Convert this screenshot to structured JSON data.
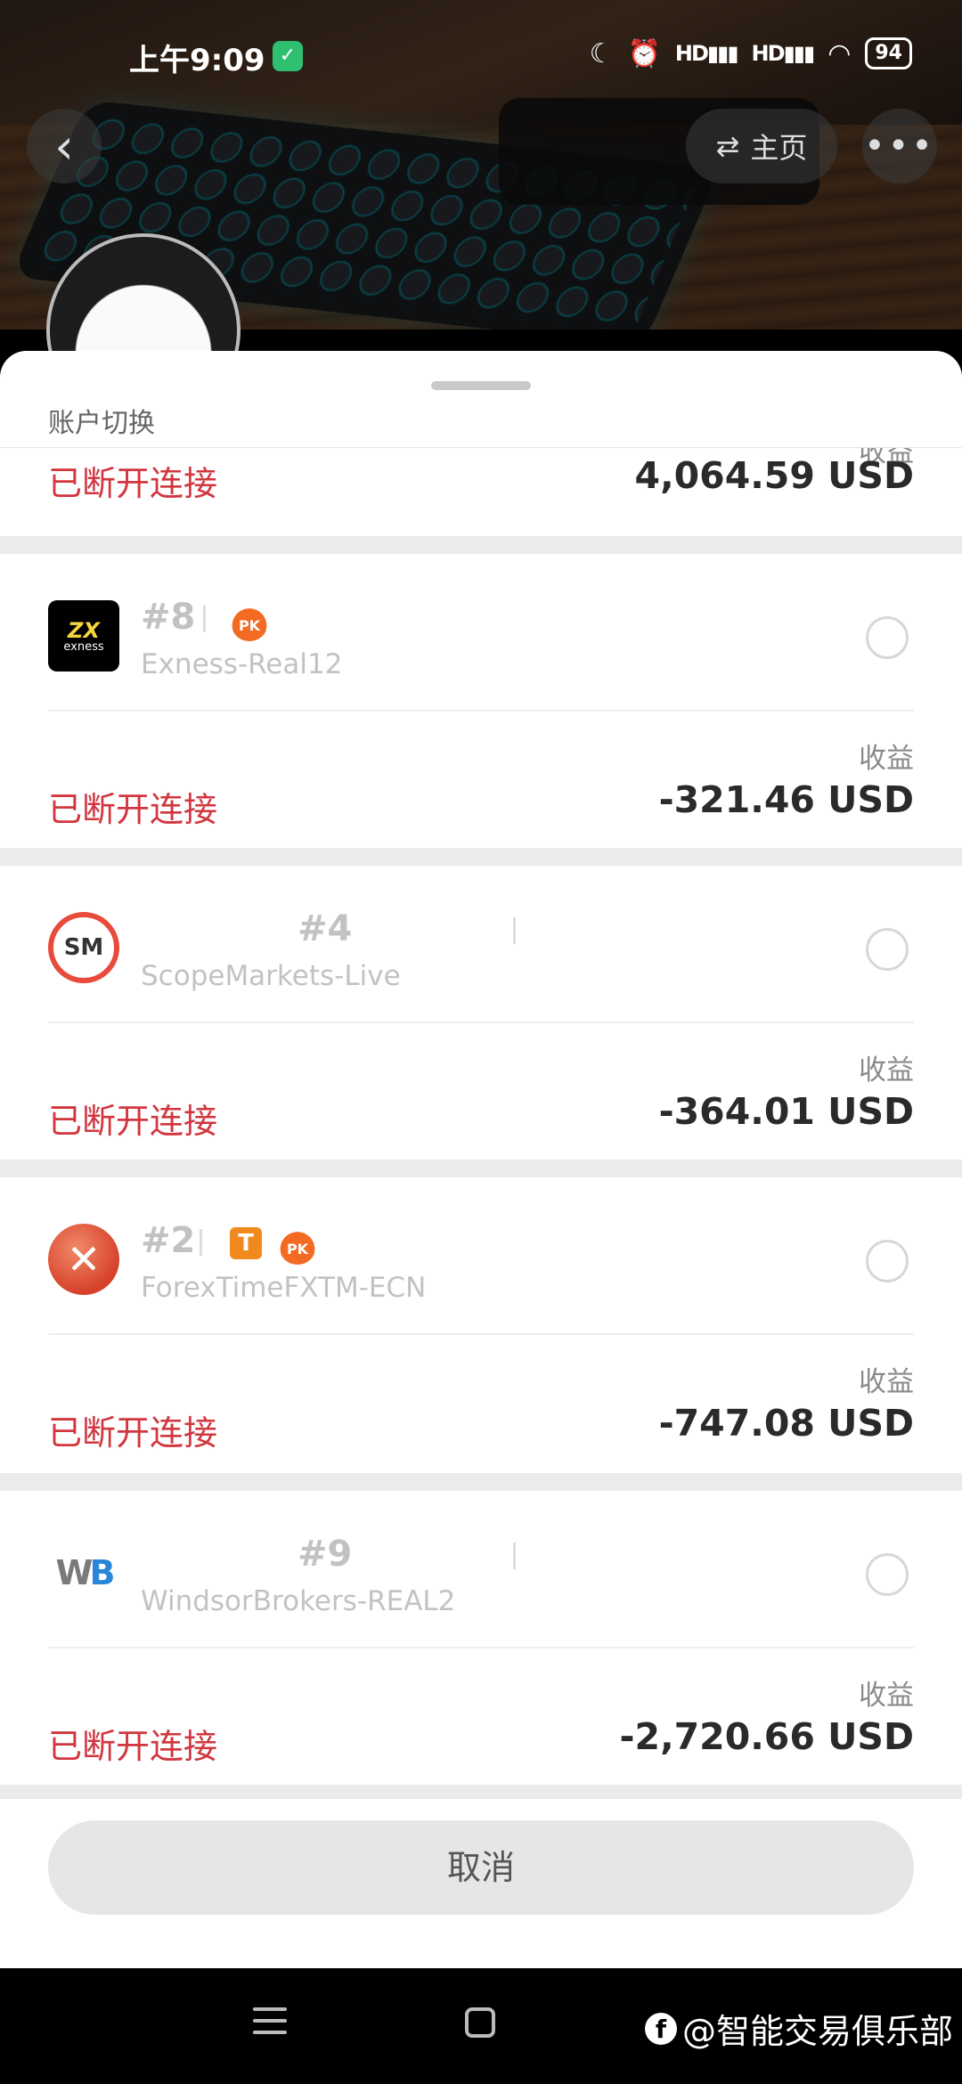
{
  "status_bar": {
    "time": "上午9:09",
    "battery": "94",
    "signal1": "HD",
    "signal2": "HD"
  },
  "header": {
    "home_label": "主页"
  },
  "sheet": {
    "title": "账户切换",
    "partial": {
      "profit_label": "收益",
      "status": "已断开连接",
      "profit": "4,064.59 USD"
    },
    "accounts": [
      {
        "number": "#8",
        "server": "Exness-Real12",
        "profit_label": "收益",
        "status": "已断开连接",
        "profit": "-321.46 USD",
        "logo_text": "exness"
      },
      {
        "number": "#4",
        "server": "ScopeMarkets-Live",
        "profit_label": "收益",
        "status": "已断开连接",
        "profit": "-364.01 USD",
        "logo_text": "SM"
      },
      {
        "number": "#2",
        "server": "ForexTimeFXTM-ECN",
        "profit_label": "收益",
        "status": "已断开连接",
        "profit": "-747.08 USD",
        "badge_t": "T"
      },
      {
        "number": "#9",
        "server": "WindsorBrokers-REAL2",
        "profit_label": "收益",
        "status": "已断开连接",
        "profit": "-2,720.66 USD",
        "logo_text": "WB"
      }
    ],
    "pk_badge": "PK",
    "cancel": "取消"
  },
  "watermark": "@智能交易俱乐部",
  "colors": {
    "disconnected": "#d2363f",
    "pk_badge": "#f36b22",
    "t_badge": "#f08a1e"
  }
}
